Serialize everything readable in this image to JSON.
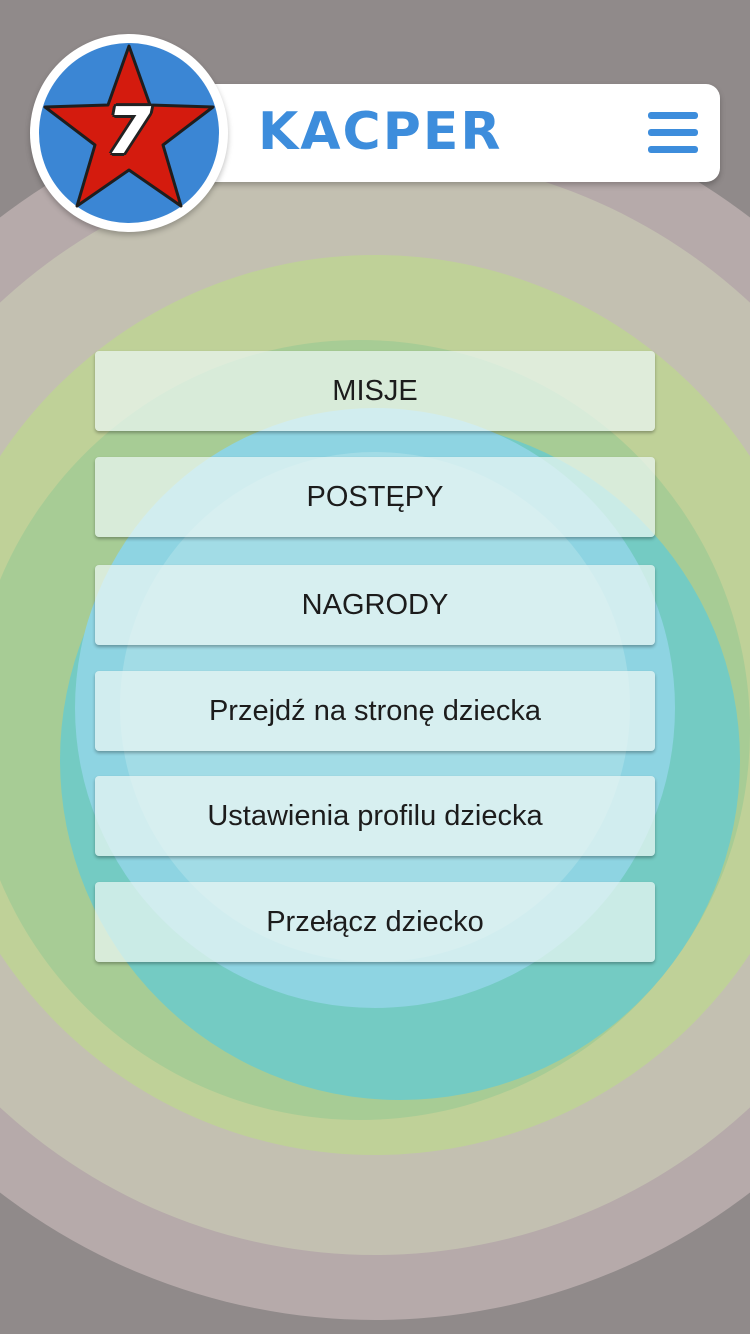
{
  "header": {
    "title": "KACPER",
    "menu_icon": "hamburger-menu-icon",
    "accent_color": "#3d8ddc"
  },
  "avatar": {
    "level": "7",
    "icon": "star-badge-icon",
    "star_color": "#d41b0e",
    "circle_color": "#3b86d4"
  },
  "menu": {
    "items": [
      {
        "label": "MISJE"
      },
      {
        "label": "POSTĘPY"
      },
      {
        "label": "NAGRODY"
      },
      {
        "label": "Przejdź na stronę dziecka"
      },
      {
        "label": "Ustawienia profilu dziecka"
      },
      {
        "label": "Przełącz dziecko"
      }
    ]
  }
}
